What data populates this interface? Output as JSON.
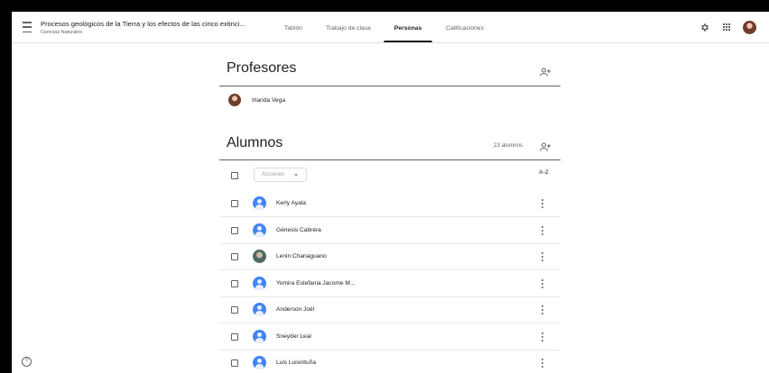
{
  "header": {
    "class_title": "Procesos geológicos de la Tierra y los efectos de las cinco extinci...",
    "class_subtitle": "Ciencias Naturales",
    "tabs": [
      {
        "label": "Tablón"
      },
      {
        "label": "Trabajo de clase"
      },
      {
        "label": "Personas",
        "active": true
      },
      {
        "label": "Calificaciones"
      }
    ]
  },
  "teachers": {
    "title": "Profesores",
    "list": [
      {
        "name": "Irlanda Vega"
      }
    ]
  },
  "students": {
    "title": "Alumnos",
    "count": "23 alumnos",
    "actions_label": "Acciones",
    "sort_icon": "A-Z",
    "list": [
      {
        "name": "Kerly Ayala",
        "avatar": "generic"
      },
      {
        "name": "Génesis Cabrera",
        "avatar": "generic"
      },
      {
        "name": "Lenin Chanaguano",
        "avatar": "photo"
      },
      {
        "name": "Yomira Estefania Jacome M...",
        "avatar": "generic"
      },
      {
        "name": "Anderson Joél",
        "avatar": "generic"
      },
      {
        "name": "Sneyder Leal",
        "avatar": "generic"
      },
      {
        "name": "Luis Luisintuña",
        "avatar": "generic"
      }
    ]
  },
  "colors": {
    "accent": "#202124",
    "avatar_blue": "#4285f4"
  },
  "icons": [
    "menu-icon",
    "settings-icon",
    "apps-icon",
    "add-person-icon",
    "sort-az-icon",
    "more-vert-icon",
    "help-icon"
  ]
}
